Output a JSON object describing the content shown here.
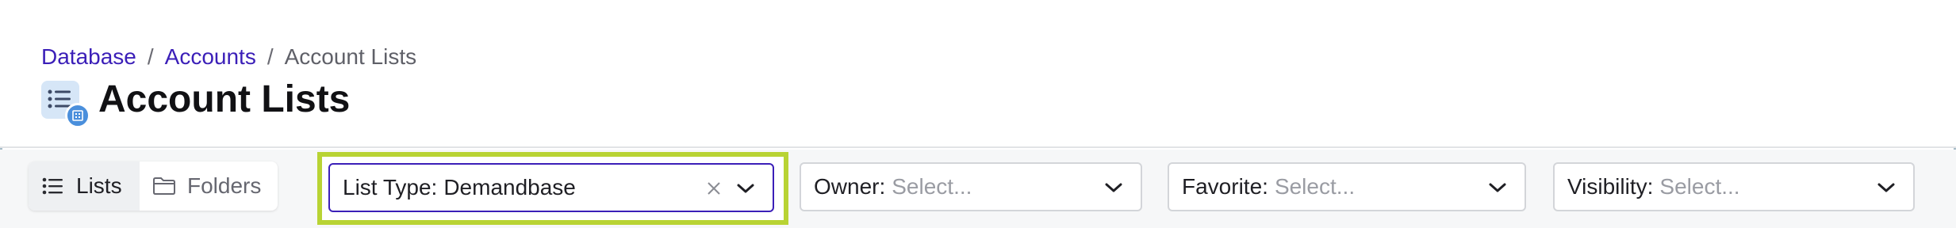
{
  "breadcrumb": {
    "items": [
      {
        "label": "Database",
        "link": true
      },
      {
        "label": "Accounts",
        "link": true
      },
      {
        "label": "Account Lists",
        "link": false
      }
    ],
    "separator": "/"
  },
  "page": {
    "title": "Account Lists",
    "icon": "account-list-icon"
  },
  "view_toggle": {
    "lists_label": "Lists",
    "folders_label": "Folders",
    "active": "Lists"
  },
  "filters": {
    "list_type": {
      "label": "List Type:",
      "value": "Demandbase"
    },
    "owner": {
      "label": "Owner:",
      "placeholder": "Select..."
    },
    "favorite": {
      "label": "Favorite:",
      "placeholder": "Select..."
    },
    "visibility": {
      "label": "Visibility:",
      "placeholder": "Select..."
    }
  },
  "colors": {
    "link": "#3b1fb8",
    "highlight": "#b8d334",
    "focus_border": "#3b1fb8",
    "icon_badge": "#4a8fdc"
  }
}
